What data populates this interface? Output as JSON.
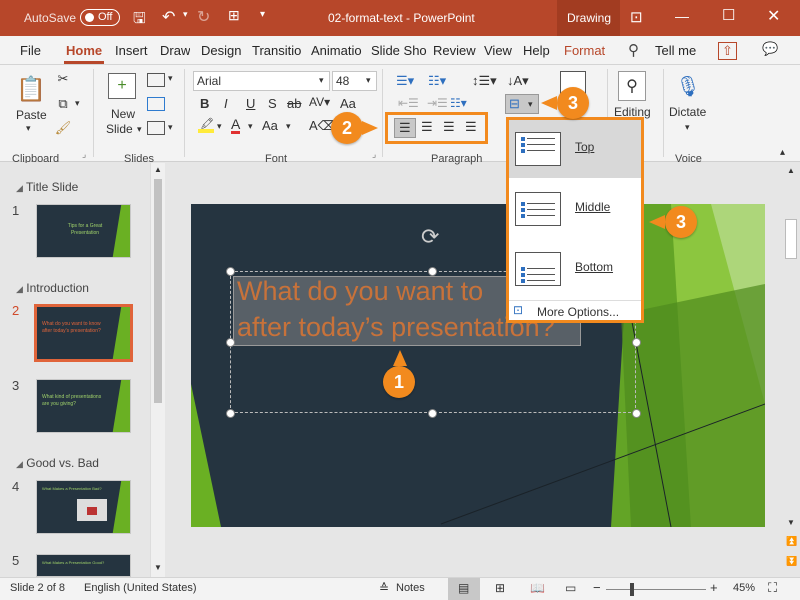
{
  "titlebar": {
    "autosave_label": "AutoSave",
    "autosave_state": "Off",
    "filename": "02-format-text",
    "app": "PowerPoint",
    "context_tab": "Drawing",
    "bg": "#b7472a"
  },
  "tabs": [
    "File",
    "Home",
    "Insert",
    "Draw",
    "Design",
    "Transitio",
    "Animatio",
    "Slide Sho",
    "Review",
    "View",
    "Help",
    "Format"
  ],
  "tell_me": "Tell me",
  "ribbon": {
    "clipboard": {
      "paste": "Paste",
      "group": "Clipboard"
    },
    "slides": {
      "new_slide_1": "New",
      "new_slide_2": "Slide",
      "group": "Slides"
    },
    "font": {
      "family": "Arial",
      "size": "48",
      "bold": "B",
      "italic": "I",
      "underline": "U",
      "shadow": "S",
      "strike": "ab",
      "font_color": "A",
      "grow": "Aa",
      "group": "Font"
    },
    "paragraph": {
      "group": "Paragraph"
    },
    "editing": "Editing",
    "dictate": "Dictate",
    "voice_group": "Voice"
  },
  "thumbnails": {
    "sections": [
      "Title Slide",
      "Introduction",
      "Good vs. Bad"
    ],
    "numbers": [
      "1",
      "2",
      "3",
      "4",
      "5"
    ],
    "slide1_title": "Tips for a Great Presentation",
    "slide2_title": "What do you want to know after today's presentation?",
    "slide3_title": "What kind of presentations are you giving?",
    "slide4_title": "What Makes a Presentation Bad?",
    "slide5_title": "What Makes a Presentation Good?"
  },
  "slide": {
    "title_line1": "What do you want to",
    "title_line2": "after today’s presentation?"
  },
  "dropdown": {
    "items": [
      "Top",
      "Middle",
      "Bottom"
    ],
    "more": "More Options..."
  },
  "callouts": {
    "c1": "1",
    "c2": "2",
    "c3a": "3",
    "c3b": "3"
  },
  "status": {
    "slide_info": "Slide 2 of 8",
    "language": "English (United States)",
    "notes": "Notes",
    "zoom": "45%"
  },
  "colors": {
    "accent": "#f28a1e",
    "slide_bg": "#253440",
    "green": "#6ab023",
    "title_text": "#c8723a"
  }
}
